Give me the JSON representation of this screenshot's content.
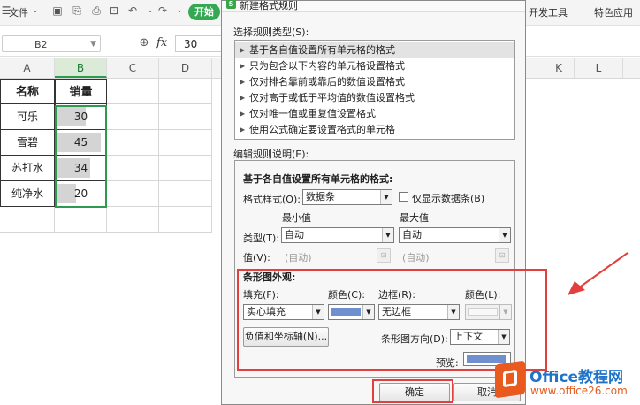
{
  "toolbar": {
    "file_label": "文件",
    "start_label": "开始",
    "dev_tools_label": "开发工具",
    "special_app_label": "特色应用"
  },
  "formula_bar": {
    "name_box": "B2",
    "fx_label": "fx",
    "value": "30"
  },
  "columns_left": [
    "A",
    "B",
    "C",
    "D"
  ],
  "columns_right": [
    "K",
    "L"
  ],
  "sheet": {
    "header_name": "名称",
    "header_sales": "销量",
    "rows": [
      {
        "name": "可乐",
        "sales": "30",
        "bar": 0.6
      },
      {
        "name": "雪碧",
        "sales": "45",
        "bar": 0.9
      },
      {
        "name": "苏打水",
        "sales": "34",
        "bar": 0.68
      },
      {
        "name": "纯净水",
        "sales": "20",
        "bar": 0.4
      }
    ],
    "accent_color": "#2e9a4f"
  },
  "dialog": {
    "title": "新建格式规则",
    "rule_type_label": "选择规则类型(S):",
    "rule_types": [
      "基于各自值设置所有单元格的格式",
      "只为包含以下内容的单元格设置格式",
      "仅对排名靠前或靠后的数值设置格式",
      "仅对高于或低于平均值的数值设置格式",
      "仅对唯一值或重复值设置格式",
      "使用公式确定要设置格式的单元格"
    ],
    "edit_desc_label": "编辑规则说明(E):",
    "desc_heading": "基于各自值设置所有单元格的格式:",
    "format_style_label": "格式样式(O):",
    "format_style_value": "数据条",
    "show_bar_only_label": "仅显示数据条(B)",
    "min_label": "最小值",
    "max_label": "最大值",
    "type_label": "类型(T):",
    "min_type": "自动",
    "max_type": "自动",
    "value_label": "值(V):",
    "min_value": "(自动)",
    "max_value": "(自动)",
    "bar_appearance_label": "条形图外观:",
    "fill_label": "填充(F):",
    "fill_value": "实心填充",
    "color1_label": "颜色(C):",
    "border_label": "边框(R):",
    "border_value": "无边框",
    "color2_label": "颜色(L):",
    "neg_axis_button": "负值和坐标轴(N)...",
    "bar_direction_label": "条形图方向(D):",
    "bar_direction_value": "上下文",
    "preview_label": "预览:",
    "ok_button": "确定",
    "cancel_button": "取消",
    "bar_color": "#6f8fcf"
  },
  "watermark": {
    "brand": "Office教程网",
    "url": "www.office26.com"
  }
}
